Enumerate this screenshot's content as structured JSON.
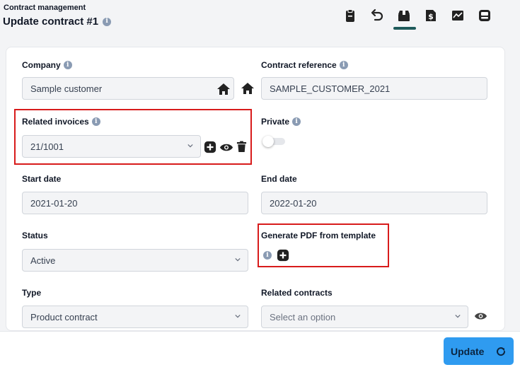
{
  "header": {
    "breadcrumb": "Contract management",
    "title": "Update contract #1",
    "toolbar": [
      "clipboard-icon",
      "undo-icon",
      "archive-box-icon",
      "dollar-file-icon",
      "chart-icon",
      "inbox-icon"
    ],
    "active_tool": "archive-box-icon",
    "accent_color": "#1e5a5a"
  },
  "form": {
    "company": {
      "label": "Company",
      "value": "Sample customer"
    },
    "contract_reference": {
      "label": "Contract reference",
      "value": "SAMPLE_CUSTOMER_2021"
    },
    "related_invoices": {
      "label": "Related invoices",
      "value": "21/1001"
    },
    "private": {
      "label": "Private",
      "checked": false
    },
    "start_date": {
      "label": "Start date",
      "value": "2021-01-20"
    },
    "end_date": {
      "label": "End date",
      "value": "2022-01-20"
    },
    "status": {
      "label": "Status",
      "value": "Active"
    },
    "generate_pdf": {
      "label": "Generate PDF from template"
    },
    "type": {
      "label": "Type",
      "value": "Product contract"
    },
    "related_contracts": {
      "label": "Related contracts",
      "placeholder": "Select an option"
    }
  },
  "info_glyph": "i",
  "footer": {
    "update_label": "Update",
    "button_color": "#2f9bf0"
  },
  "highlight_color": "#d81b1b"
}
